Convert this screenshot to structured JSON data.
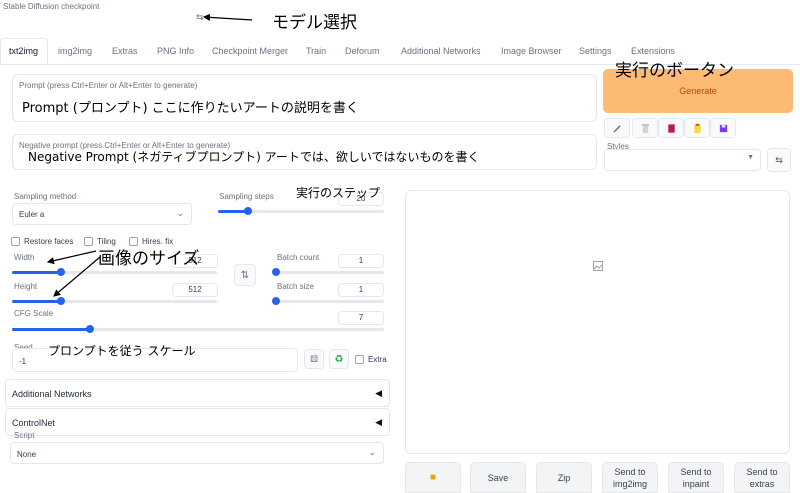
{
  "checkpoint": {
    "label": "Stable Diffusion checkpoint",
    "refresh_icon": "refresh-icon"
  },
  "tabs": [
    "txt2img",
    "img2img",
    "Extras",
    "PNG Info",
    "Checkpoint Merger",
    "Train",
    "Deforum",
    "Additional Networks",
    "Image Browser",
    "Settings",
    "Extensions"
  ],
  "active_tab": "txt2img",
  "prompt": {
    "placeholder": "Prompt (press Ctrl+Enter or Alt+Enter to generate)"
  },
  "negative_prompt": {
    "placeholder": "Negative prompt (press Ctrl+Enter or Alt+Enter to generate)"
  },
  "generate_label": "Generate",
  "styles_label": "Styles",
  "sampling": {
    "method_label": "Sampling method",
    "method_value": "Euler a",
    "steps_label": "Sampling steps",
    "steps_value": "20",
    "steps_fraction": 0.18
  },
  "options": {
    "restore_faces": "Restore faces",
    "tiling": "Tiling",
    "hires_fix": "Hires. fix"
  },
  "width": {
    "label": "Width",
    "value": "512",
    "fraction": 0.24
  },
  "height": {
    "label": "Height",
    "value": "512",
    "fraction": 0.24
  },
  "batch_count": {
    "label": "Batch count",
    "value": "1",
    "fraction": 0.0
  },
  "batch_size": {
    "label": "Batch size",
    "value": "1",
    "fraction": 0.0
  },
  "cfg": {
    "label": "CFG Scale",
    "value": "7",
    "fraction": 0.21
  },
  "seed": {
    "label": "Seed",
    "value": "-1",
    "extra_label": "Extra"
  },
  "accordions": {
    "additional_networks": "Additional Networks",
    "controlnet": "ControlNet"
  },
  "script": {
    "label": "Script",
    "value": "None"
  },
  "output_buttons": {
    "save": "Save",
    "zip": "Zip",
    "send_img2img": "Send to img2img",
    "send_inpaint": "Send to inpaint",
    "send_extras": "Send to extras"
  },
  "annotations": {
    "model_select": "モデル選択",
    "run_button": "実行のボータン",
    "prompt_note": "Prompt (プロンプト) ここに作りたいアートの説明を書く",
    "negative_note": "Negative Prompt (ネガティブプロンプト) アートでは、欲しいではないものを書く",
    "steps_note": "実行のステップ",
    "size_note": "画像のサイズ",
    "cfg_note": "プロンプトを従う スケール"
  },
  "colors": {
    "accent": "#2563eb",
    "generate_bg": "#fdba74",
    "generate_text": "#c2410c"
  }
}
